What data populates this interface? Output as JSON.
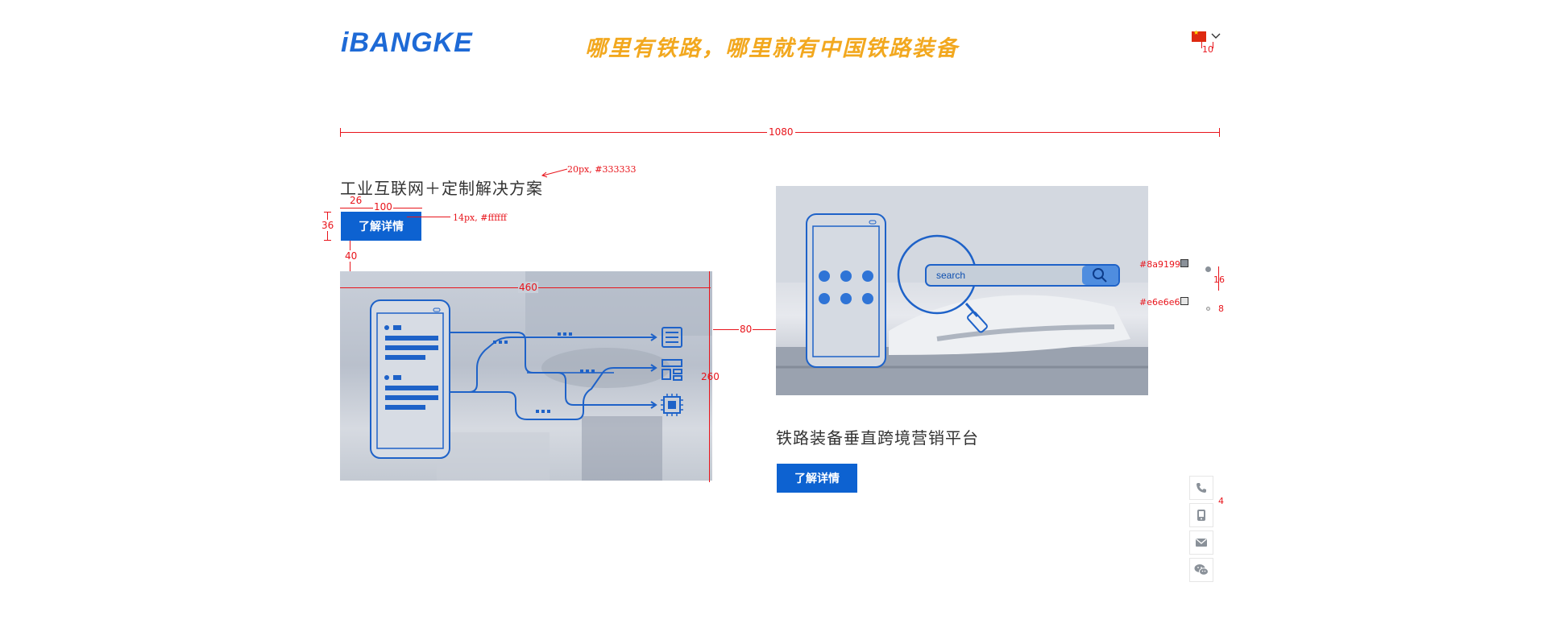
{
  "header": {
    "logo": "iBANGKE",
    "slogan": "哪里有铁路，哪里就有中国铁路装备",
    "language_icon": "china-flag-icon"
  },
  "sections": [
    {
      "title": "工业互联网＋定制解决方案",
      "button": "了解详情",
      "image": "industrial-internet-illustration"
    },
    {
      "title": "铁路装备垂直跨境营销平台",
      "button": "了解详情",
      "image": "railway-search-illustration",
      "search_label": "search"
    }
  ],
  "sidebar": {
    "items": [
      {
        "icon": "phone-icon"
      },
      {
        "icon": "mobile-icon"
      },
      {
        "icon": "mail-icon"
      },
      {
        "icon": "wechat-icon"
      }
    ]
  },
  "annotations": {
    "width_total": "1080",
    "title_note": "20px, #333333",
    "button_note": "14px, #ffffff",
    "gap_title_button": "26",
    "button_width": "100",
    "button_height": "36",
    "gap_button_image": "40",
    "image_width": "460",
    "image_height": "260",
    "column_gap": "80",
    "flag_gap": "10",
    "color_dark": "#8a9199",
    "color_light": "#e6e6e6",
    "sidebar_size": "16",
    "sidebar_gap": "8",
    "sidebar_spacing": "4"
  },
  "colors": {
    "primary": "#0d62d1",
    "title": "#333333",
    "slogan": "#f2a81f",
    "annotation": "#e8141b"
  }
}
